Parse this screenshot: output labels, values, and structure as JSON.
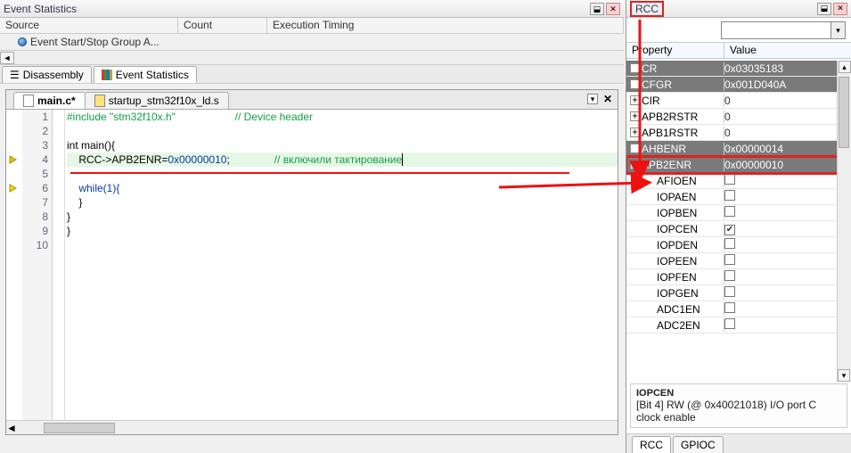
{
  "left": {
    "title": "Event Statistics",
    "columns": {
      "src": "Source",
      "cnt": "Count",
      "exe": "Execution Timing"
    },
    "eventRow": "Event Start/Stop Group A...",
    "tabs": {
      "disasm": "Disassembly",
      "evstat": "Event Statistics"
    },
    "files": {
      "main": "main.c*",
      "startup": "startup_stm32f10x_ld.s"
    }
  },
  "code": {
    "l1a": "#include ",
    "l1b": "\"stm32f10x.h\"",
    "l1c": "                    // Device header",
    "l3": "int main(){",
    "l4a": "    RCC->APB2ENR=",
    "l4b": "0x00000010",
    "l4c": ";",
    "l4d": "               // включили тактирование",
    "l6": "    while(1){",
    "l7": "    }",
    "l8": "}",
    "l9": "}",
    "ln1": "1",
    "ln2": "2",
    "ln3": "3",
    "ln4": "4",
    "ln5": "5",
    "ln6": "6",
    "ln7": "7",
    "ln8": "8",
    "ln9": "9",
    "ln10": "10"
  },
  "right": {
    "title": "RCC",
    "head": {
      "prop": "Property",
      "val": "Value"
    },
    "rows": [
      {
        "exp": "+",
        "name": "CR",
        "val": "0x03035183",
        "sel": true
      },
      {
        "exp": "+",
        "name": "CFGR",
        "val": "0x001D040A",
        "sel": true
      },
      {
        "exp": "+",
        "name": "CIR",
        "val": "0",
        "sel": false
      },
      {
        "exp": "+",
        "name": "APB2RSTR",
        "val": "0",
        "sel": false
      },
      {
        "exp": "+",
        "name": "APB1RSTR",
        "val": "0",
        "sel": false
      },
      {
        "exp": "+",
        "name": "AHBENR",
        "val": "0x00000014",
        "sel": true
      },
      {
        "exp": "-",
        "name": "APB2ENR",
        "val": "0x00000010",
        "sel": true,
        "hl": true
      }
    ],
    "subs": [
      {
        "name": "AFIOEN",
        "chk": false
      },
      {
        "name": "IOPAEN",
        "chk": false
      },
      {
        "name": "IOPBEN",
        "chk": false
      },
      {
        "name": "IOPCEN",
        "chk": true
      },
      {
        "name": "IOPDEN",
        "chk": false
      },
      {
        "name": "IOPEEN",
        "chk": false
      },
      {
        "name": "IOPFEN",
        "chk": false
      },
      {
        "name": "IOPGEN",
        "chk": false
      },
      {
        "name": "ADC1EN",
        "chk": false
      },
      {
        "name": "ADC2EN",
        "chk": false
      }
    ],
    "info": {
      "name": "IOPCEN",
      "desc": "[Bit 4] RW (@ 0x40021018) I/O port C clock enable"
    },
    "btabs": {
      "rcc": "RCC",
      "gpioc": "GPIOC"
    }
  }
}
